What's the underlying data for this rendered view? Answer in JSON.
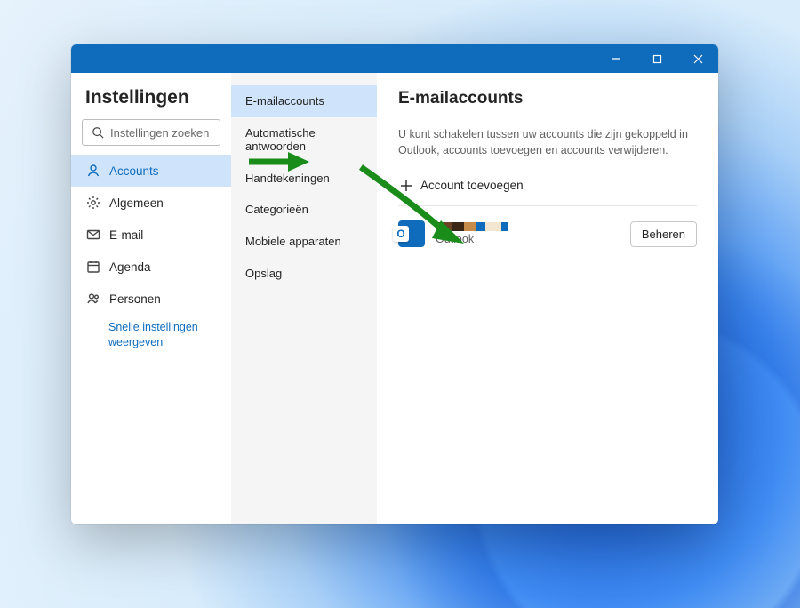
{
  "titlebar": {
    "minimize": "–",
    "maximize": "▢",
    "close": "✕"
  },
  "settings": {
    "title": "Instellingen",
    "search_placeholder": "Instellingen zoeken"
  },
  "nav1": {
    "items": [
      {
        "label": "Accounts"
      },
      {
        "label": "Algemeen"
      },
      {
        "label": "E-mail"
      },
      {
        "label": "Agenda"
      },
      {
        "label": "Personen"
      }
    ],
    "link": "Snelle instellingen weergeven"
  },
  "nav2": {
    "items": [
      {
        "label": "E-mailaccounts"
      },
      {
        "label": "Automatische antwoorden"
      },
      {
        "label": "Handtekeningen"
      },
      {
        "label": "Categorieën"
      },
      {
        "label": "Mobiele apparaten"
      },
      {
        "label": "Opslag"
      }
    ]
  },
  "pane": {
    "title": "E-mailaccounts",
    "description": "U kunt schakelen tussen uw accounts die zijn gekoppeld in Outlook, accounts toevoegen en accounts verwijderen.",
    "add_account": "Account toevoegen",
    "account_name": "Outlook",
    "manage": "Beheren"
  },
  "redaction_colors": [
    "#6b4226",
    "#3a2615",
    "#c58b4a",
    "#0f6cbd",
    "#f2e6d0",
    "#0f6cbd"
  ],
  "colors": {
    "accent": "#0f6cbd",
    "arrow": "#1a8c1a"
  }
}
